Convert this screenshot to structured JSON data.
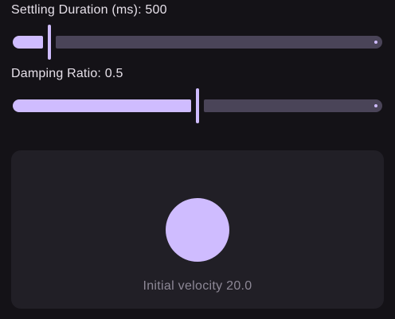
{
  "sliders": {
    "duration": {
      "label": "Settling Duration (ms): 500",
      "value": 500,
      "fraction": 0.1
    },
    "damping": {
      "label": "Damping Ratio: 0.5",
      "value": 0.5,
      "fraction": 0.5
    }
  },
  "preview": {
    "velocity_text": "Initial velocity 20.0"
  },
  "colors": {
    "background": "#141217",
    "accent": "#cfbcff",
    "track_inactive": "#4a4458",
    "card": "#211f26",
    "muted_text": "#8d8896"
  }
}
